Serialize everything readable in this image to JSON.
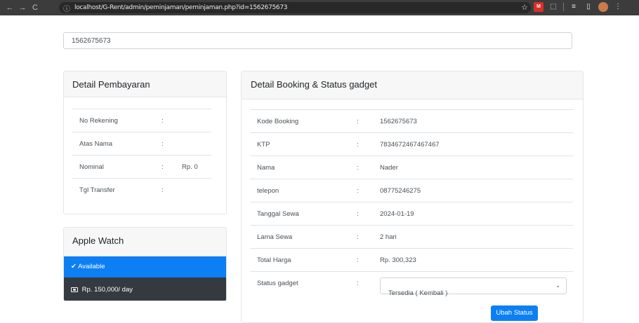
{
  "browser": {
    "url": "localhost/G-Rent/admin/peminjaman/peminjaman.php?id=1562675673",
    "nav_back_icon": "←",
    "nav_forward_icon": "→",
    "reload_icon": "C",
    "info_icon": "ⓘ",
    "star_icon": "☆",
    "ext_red_label": "M",
    "puzzle_icon": "⬚",
    "menu_icon": "⋮"
  },
  "top_input": {
    "value": "1562675673"
  },
  "payment": {
    "title": "Detail Pembayaran",
    "rows": [
      {
        "label": "No Rekening",
        "colon": ":",
        "value": ""
      },
      {
        "label": "Atas Nama",
        "colon": ":",
        "value": ""
      },
      {
        "label": "Nominal",
        "colon": ":",
        "value": "Rp. 0"
      },
      {
        "label": "Tgl Transfer",
        "colon": ":",
        "value": ""
      }
    ]
  },
  "booking": {
    "title": "Detail Booking & Status gadget",
    "rows": [
      {
        "label": "Kode Booking",
        "colon": ":",
        "value": "1562675673"
      },
      {
        "label": "KTP",
        "colon": ":",
        "value": "7834672467467467"
      },
      {
        "label": "Nama",
        "colon": ":",
        "value": "Nader"
      },
      {
        "label": "telepon",
        "colon": ":",
        "value": "08775246275"
      },
      {
        "label": "Tanggal Sewa",
        "colon": ":",
        "value": "2024-01-19"
      },
      {
        "label": "Lama Sewa",
        "colon": ":",
        "value": "2 hari"
      },
      {
        "label": "Total Harga",
        "colon": ":",
        "value": "Rp. 300,323"
      }
    ],
    "status": {
      "label": "Status gadget",
      "colon": ":",
      "selected": "Tersedia ( Kembali )"
    },
    "submit_label": "Ubah Status"
  },
  "gadget": {
    "title": "Apple Watch",
    "availability": "Available",
    "price": "Rp. 150,000/ day"
  },
  "colors": {
    "primary": "#0d7ff5",
    "dark": "#343a40",
    "chrome": "#3c3c3c"
  }
}
